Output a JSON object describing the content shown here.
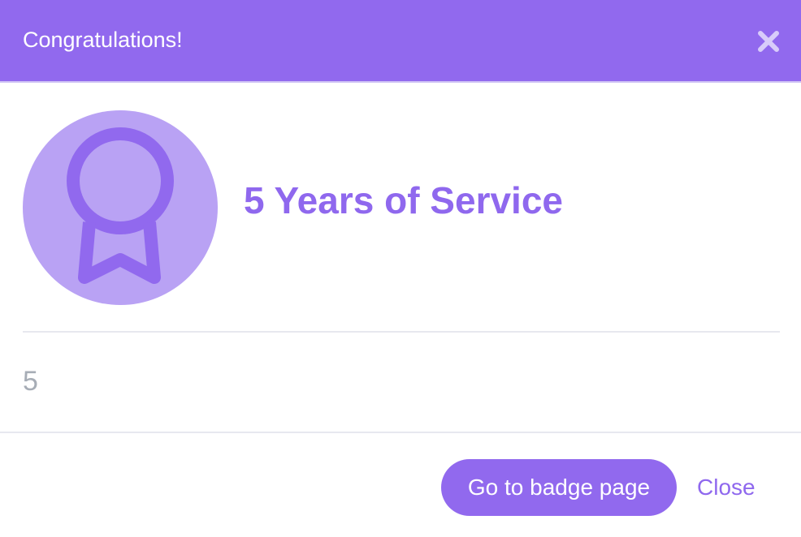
{
  "header": {
    "title": "Congratulations!",
    "close_icon": "close-icon"
  },
  "badge": {
    "icon": "ribbon-medal-icon",
    "title": "5 Years of Service",
    "description": "5",
    "circle_color": "#b9a2f4",
    "icon_color": "#9169ee"
  },
  "footer": {
    "primary_label": "Go to badge page",
    "secondary_label": "Close"
  },
  "colors": {
    "accent": "#9169ee",
    "muted_text": "#a7adb6"
  }
}
